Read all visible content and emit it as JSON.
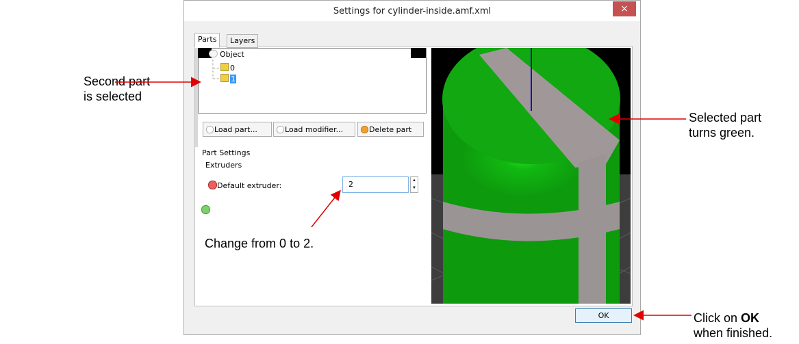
{
  "window": {
    "title": "Settings for cylinder-inside.amf.xml",
    "close_glyph": "×"
  },
  "tabs": [
    {
      "label": "Parts",
      "active": true
    },
    {
      "label": "Layers",
      "active": false
    }
  ],
  "tree": {
    "root": "Object",
    "children": [
      {
        "label": "0",
        "selected": false
      },
      {
        "label": "1",
        "selected": true
      }
    ]
  },
  "buttons": {
    "load_part": "Load part...",
    "load_modifier": "Load modifier...",
    "delete_part": "Delete part",
    "ok": "OK"
  },
  "part_settings": {
    "heading": "Part Settings",
    "group": "Extruders",
    "field_label": "Default extruder:",
    "field_value": "2"
  },
  "annotations": {
    "second_part_line1": "Second part",
    "second_part_line2": "is selected",
    "selected_line1": "Selected part",
    "selected_line2": "turns green.",
    "change": "Change from 0 to 2.",
    "click_prefix": "Click on ",
    "click_bold": "OK",
    "click_line2": "when finished."
  },
  "icons": {
    "object": "object-icon",
    "part": "cube-icon",
    "remove": "remove-icon",
    "add": "add-icon"
  },
  "colors": {
    "selected_part": "#1a9e1a",
    "other_part": "#9c9494",
    "arrow": "#e00000",
    "tree_selection": "#3399ff"
  }
}
